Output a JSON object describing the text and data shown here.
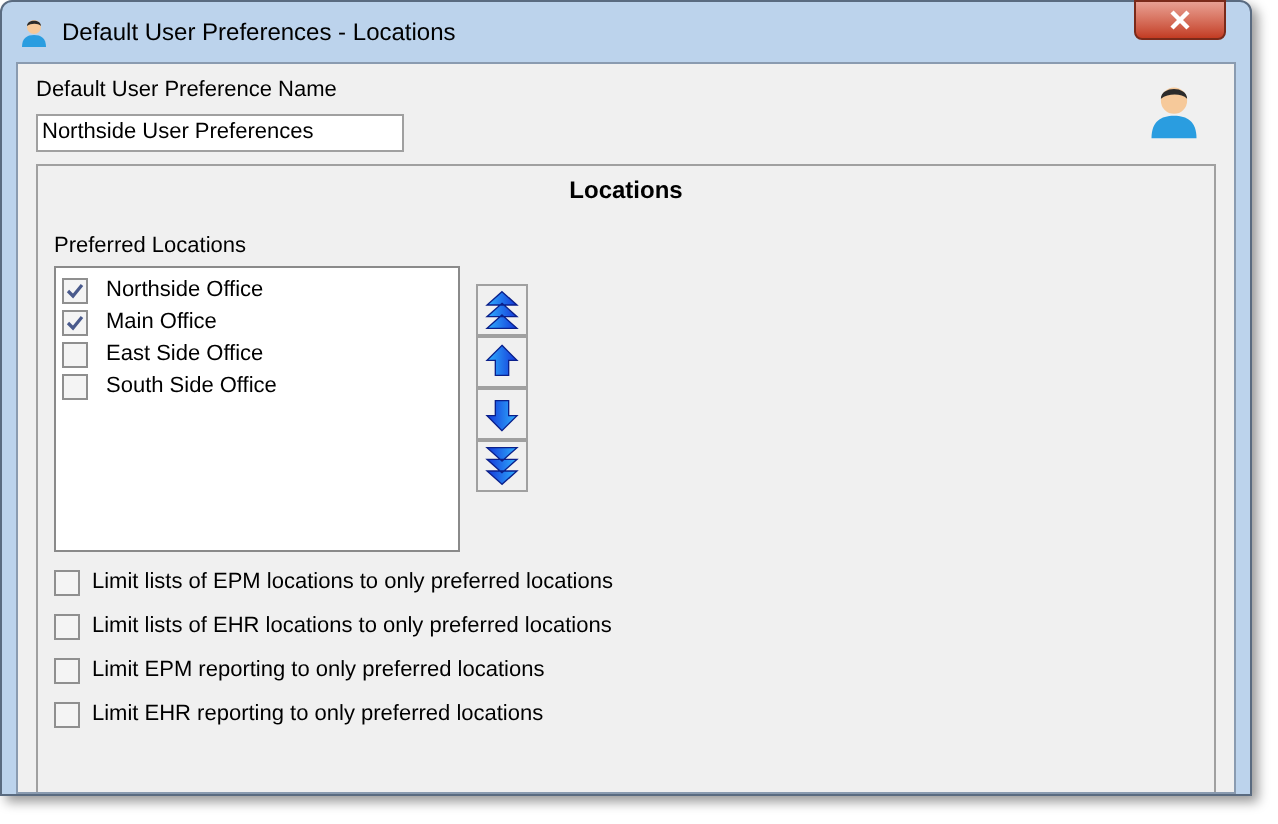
{
  "window": {
    "title": "Default User Preferences - Locations"
  },
  "name_field": {
    "label": "Default User Preference Name",
    "value": "Northside User Preferences"
  },
  "panel": {
    "title": "Locations",
    "list_label": "Preferred Locations",
    "locations": [
      {
        "label": "Northside Office",
        "checked": true
      },
      {
        "label": "Main Office",
        "checked": true
      },
      {
        "label": "East Side Office",
        "checked": false
      },
      {
        "label": "South Side Office",
        "checked": false
      }
    ],
    "move_buttons": [
      {
        "kind": "top"
      },
      {
        "kind": "up"
      },
      {
        "kind": "down"
      },
      {
        "kind": "bottom"
      }
    ],
    "options": [
      {
        "label": "Limit lists of EPM locations to only preferred locations",
        "checked": false
      },
      {
        "label": "Limit lists of EHR locations to only preferred locations",
        "checked": false
      },
      {
        "label": "Limit EPM reporting to only preferred locations",
        "checked": false
      },
      {
        "label": "Limit EHR reporting to only preferred locations",
        "checked": false
      }
    ]
  }
}
